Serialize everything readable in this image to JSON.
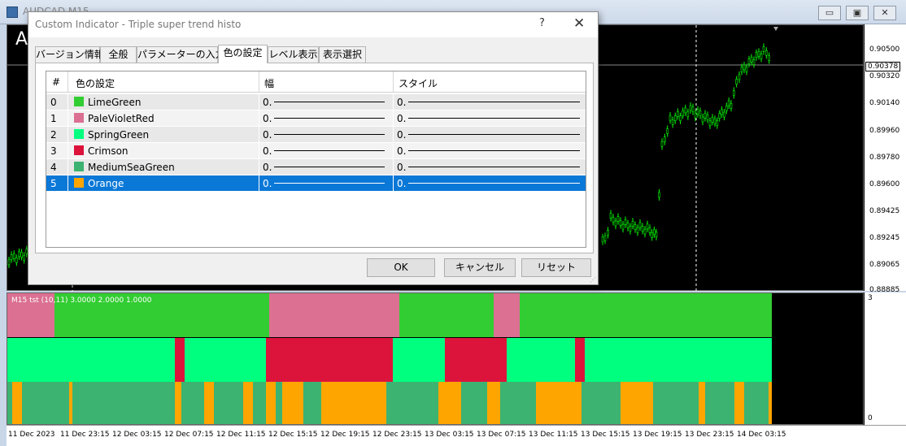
{
  "mdi": {
    "title": "AUDCAD,M15",
    "minimize": "▭",
    "restore": "▣",
    "close": "✕"
  },
  "chart": {
    "symbol_partial": "A",
    "price_ticks": [
      "0.90500",
      "0.90320",
      "0.90140",
      "0.89960",
      "0.89780",
      "0.89600",
      "0.89425",
      "0.89245",
      "0.89065",
      "0.88885"
    ],
    "current_price": "0.90378",
    "time_ticks": [
      "11 Dec 2023",
      "11 Dec 23:15",
      "12 Dec 03:15",
      "12 Dec 07:15",
      "12 Dec 11:15",
      "12 Dec 15:15",
      "12 Dec 19:15",
      "12 Dec 23:15",
      "13 Dec 03:15",
      "13 Dec 07:15",
      "13 Dec 11:15",
      "13 Dec 15:15",
      "13 Dec 19:15",
      "13 Dec 23:15",
      "14 Dec 03:15"
    ]
  },
  "subwindow": {
    "label": "M15 tst (10,11) 3.0000 2.0000 1.0000",
    "axis_top": "3",
    "axis_bottom": "0",
    "colors": {
      "lime": "#32cd32",
      "pink": "#db7093",
      "spring": "#00ff7f",
      "crimson": "#dc143c",
      "seagreen": "#3cb371",
      "orange": "#ffa500"
    }
  },
  "dialog": {
    "title": "Custom Indicator - Triple super trend histo",
    "help": "?",
    "close": "✕",
    "tabs": [
      "バージョン情報",
      "全般",
      "パラメーターの入力",
      "色の設定",
      "レベル表示",
      "表示選択"
    ],
    "active_tab": "色の設定",
    "columns": [
      "#",
      "色の設定",
      "幅",
      "スタイル"
    ],
    "rows": [
      {
        "index": "0",
        "color_name": "LimeGreen",
        "color": "#32cd32",
        "width": "0.",
        "style": "0."
      },
      {
        "index": "1",
        "color_name": "PaleVioletRed",
        "color": "#db7093",
        "width": "0.",
        "style": "0."
      },
      {
        "index": "2",
        "color_name": "SpringGreen",
        "color": "#00ff7f",
        "width": "0.",
        "style": "0."
      },
      {
        "index": "3",
        "color_name": "Crimson",
        "color": "#dc143c",
        "width": "0.",
        "style": "0."
      },
      {
        "index": "4",
        "color_name": "MediumSeaGreen",
        "color": "#3cb371",
        "width": "0.",
        "style": "0."
      },
      {
        "index": "5",
        "color_name": "Orange",
        "color": "#ffa500",
        "width": "0.",
        "style": "0."
      }
    ],
    "selected_row": "5",
    "ok_label": "OK",
    "cancel_label": "キャンセル",
    "reset_label": "リセット"
  }
}
